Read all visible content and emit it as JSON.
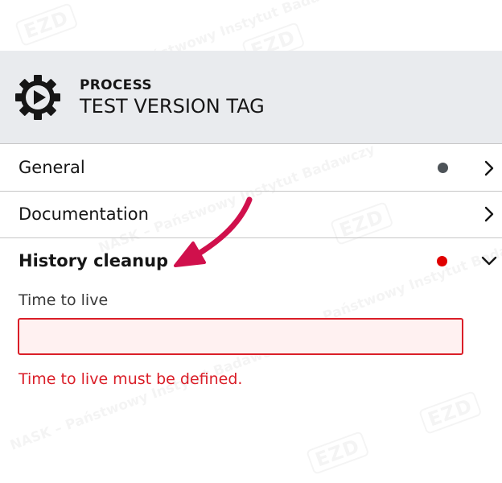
{
  "watermark": {
    "text": "NASK – Państwowy Instytut Badawczy",
    "logo": "EZD"
  },
  "header": {
    "icon": "process-gear-play-icon",
    "type_label": "PROCESS",
    "name": "TEST VERSION TAG"
  },
  "sections": [
    {
      "label": "General",
      "status": "unknown",
      "status_color": "#4d5358",
      "expanded": false
    },
    {
      "label": "Documentation",
      "status": "none",
      "expanded": false
    },
    {
      "label": "History cleanup",
      "status": "error",
      "status_color": "#e00000",
      "expanded": true
    }
  ],
  "history_cleanup": {
    "field_label": "Time to live",
    "field_value": "",
    "error_message": "Time to live must be defined."
  },
  "colors": {
    "error": "#da1e28",
    "header_bg": "#e9ebee",
    "annotation_arrow": "#d0104c"
  }
}
